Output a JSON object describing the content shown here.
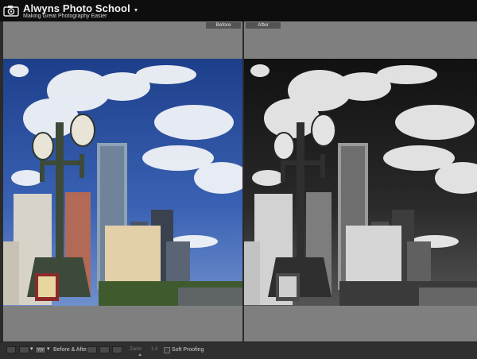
{
  "header": {
    "title": "Alwyns Photo School",
    "subtitle": "Making Great Photography Easier",
    "icon": "camera-icon"
  },
  "compare": {
    "before_label": "Before",
    "after_label": "After"
  },
  "toolbar": {
    "before_after_label": "Before & After :",
    "zoom_label": "Zoom",
    "zoom_value": "1:4",
    "soft_proofing_label": "Soft Proofing",
    "soft_proofing_checked": false,
    "view_icons": [
      "loupe-view-icon",
      "compare-view-icon",
      "before-after-view-icon"
    ],
    "swap_icons": [
      "swap-left-right-icon",
      "copy-before-to-after-icon",
      "copy-after-to-before-icon"
    ]
  }
}
